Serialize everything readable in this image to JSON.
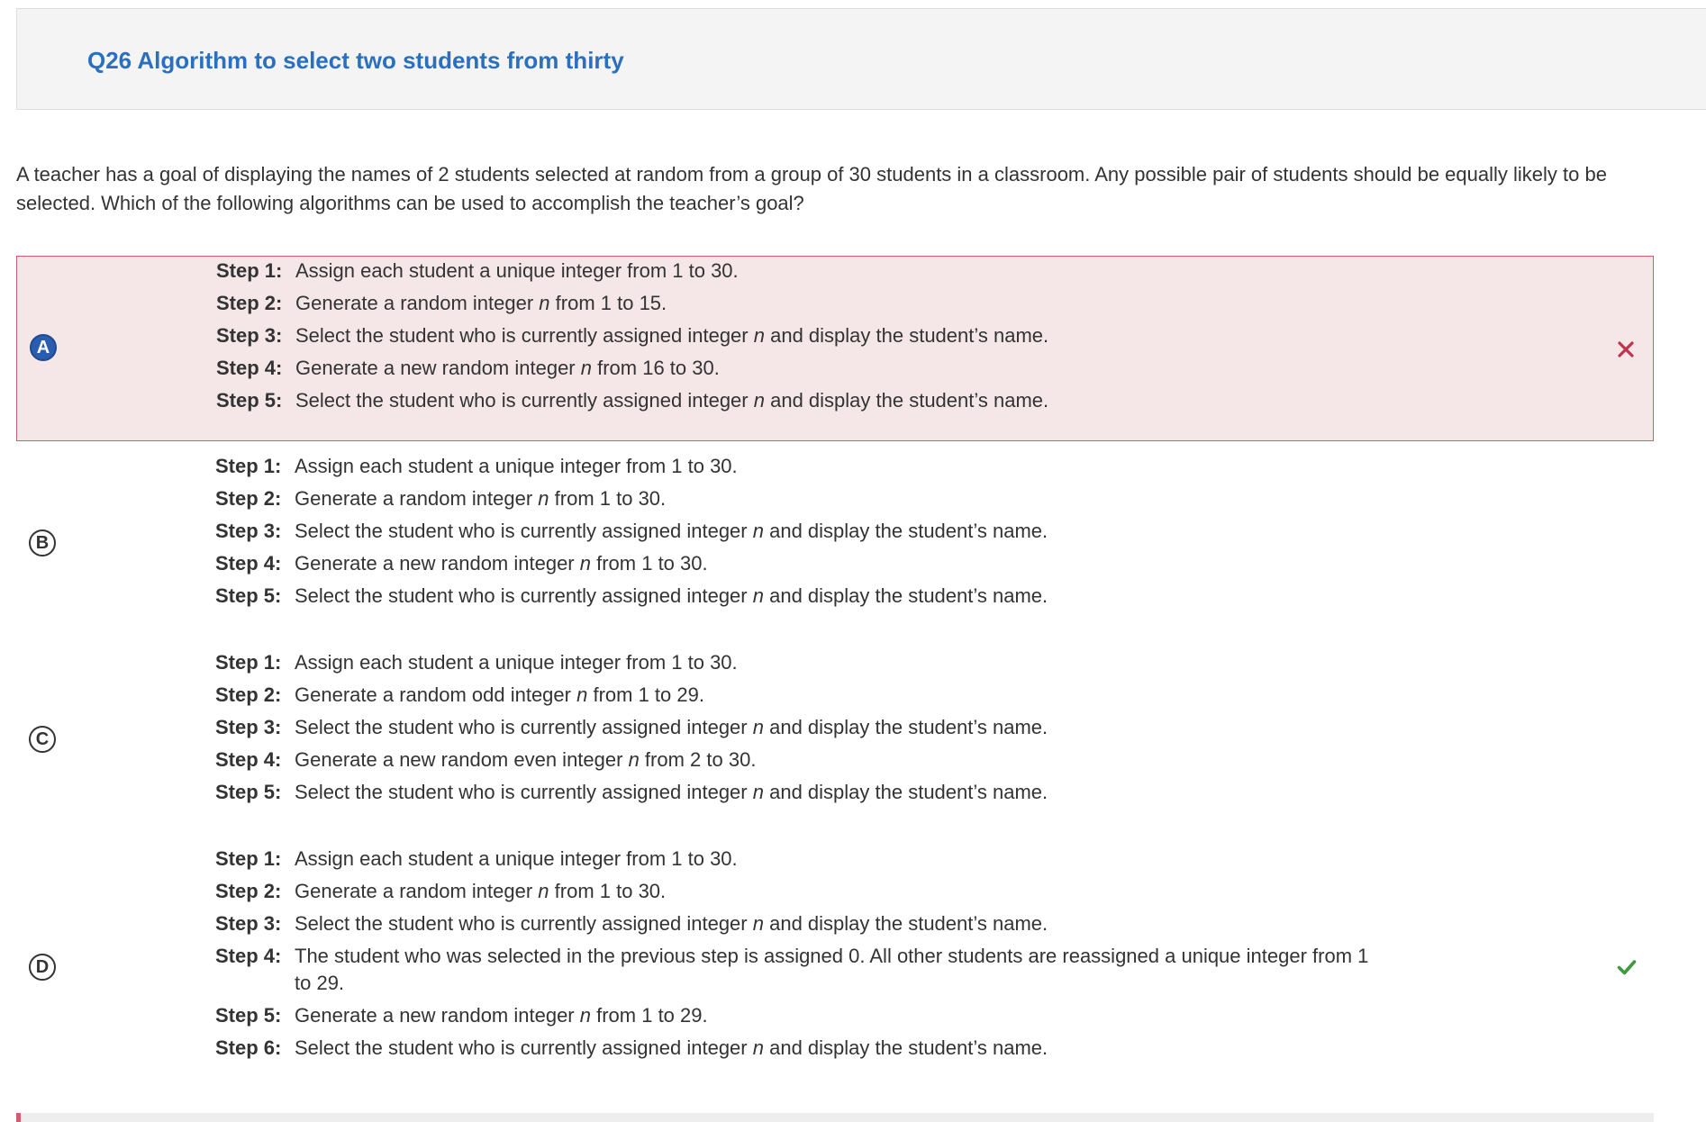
{
  "header": {
    "title": "Q26 Algorithm to select two students from thirty"
  },
  "question": {
    "text": "A teacher has a goal of displaying the names of 2 students selected at random from a group of 30 students in a classroom. Any possible pair of students should be equally likely to be selected. Which of the following algorithms can be used to accomplish the teacher’s goal?"
  },
  "colors": {
    "title": "#2a70bf",
    "wrong_bg": "#f5e6e8",
    "wrong_border": "#d35c6c",
    "selected_badge": "#2a5db0",
    "incorrect_mark": "#c0334a",
    "correct_mark": "#3f9a3f"
  },
  "options": [
    {
      "letter": "A",
      "selected": true,
      "result": "incorrect",
      "result_icon": "x-icon",
      "steps": [
        {
          "label": "Step 1:",
          "before": "Assign each student a unique integer from 1 to 30."
        },
        {
          "label": "Step 2:",
          "before": "Generate a random integer ",
          "var": "n",
          "after": " from 1 to 15."
        },
        {
          "label": "Step 3:",
          "before": "Select the student who is currently assigned integer ",
          "var": "n",
          "after": " and display the student’s name."
        },
        {
          "label": "Step 4:",
          "before": "Generate a new random integer ",
          "var": "n",
          "after": " from 16 to 30."
        },
        {
          "label": "Step 5:",
          "before": "Select the student who is currently assigned integer ",
          "var": "n",
          "after": " and display the student’s name."
        }
      ]
    },
    {
      "letter": "B",
      "selected": false,
      "result": "",
      "result_icon": "",
      "steps": [
        {
          "label": "Step 1:",
          "before": "Assign each student a unique integer from 1 to 30."
        },
        {
          "label": "Step 2:",
          "before": "Generate a random integer ",
          "var": "n",
          "after": " from 1 to 30."
        },
        {
          "label": "Step 3:",
          "before": "Select the student who is currently assigned integer ",
          "var": "n",
          "after": " and display the student’s name."
        },
        {
          "label": "Step 4:",
          "before": "Generate a new random integer ",
          "var": "n",
          "after": " from 1 to 30."
        },
        {
          "label": "Step 5:",
          "before": "Select the student who is currently assigned integer ",
          "var": "n",
          "after": " and display the student’s name."
        }
      ]
    },
    {
      "letter": "C",
      "selected": false,
      "result": "",
      "result_icon": "",
      "steps": [
        {
          "label": "Step 1:",
          "before": "Assign each student a unique integer from 1 to 30."
        },
        {
          "label": "Step 2:",
          "before": "Generate a random odd integer ",
          "var": "n",
          "after": " from 1 to 29."
        },
        {
          "label": "Step 3:",
          "before": "Select the student who is currently assigned integer ",
          "var": "n",
          "after": " and display the student’s name."
        },
        {
          "label": "Step 4:",
          "before": "Generate a new random even integer ",
          "var": "n",
          "after": " from 2 to 30."
        },
        {
          "label": "Step 5:",
          "before": "Select the student who is currently assigned integer ",
          "var": "n",
          "after": " and display the student’s name."
        }
      ]
    },
    {
      "letter": "D",
      "selected": false,
      "result": "correct",
      "result_icon": "checkmark-icon",
      "steps": [
        {
          "label": "Step 1:",
          "before": "Assign each student a unique integer from 1 to 30."
        },
        {
          "label": "Step 2:",
          "before": "Generate a random integer ",
          "var": "n",
          "after": " from 1 to 30."
        },
        {
          "label": "Step 3:",
          "before": "Select the student who is currently assigned integer ",
          "var": "n",
          "after": " and display the student’s name."
        },
        {
          "label": "Step 4:",
          "before": "The student who was selected in the previous step is assigned 0. All other students are reassigned a unique integer from 1 to 29."
        },
        {
          "label": "Step 5:",
          "before": "Generate a new random integer ",
          "var": "n",
          "after": " from 1 to 29."
        },
        {
          "label": "Step 6:",
          "before": "Select the student who is currently assigned integer ",
          "var": "n",
          "after": " and display the student’s name."
        }
      ]
    }
  ]
}
